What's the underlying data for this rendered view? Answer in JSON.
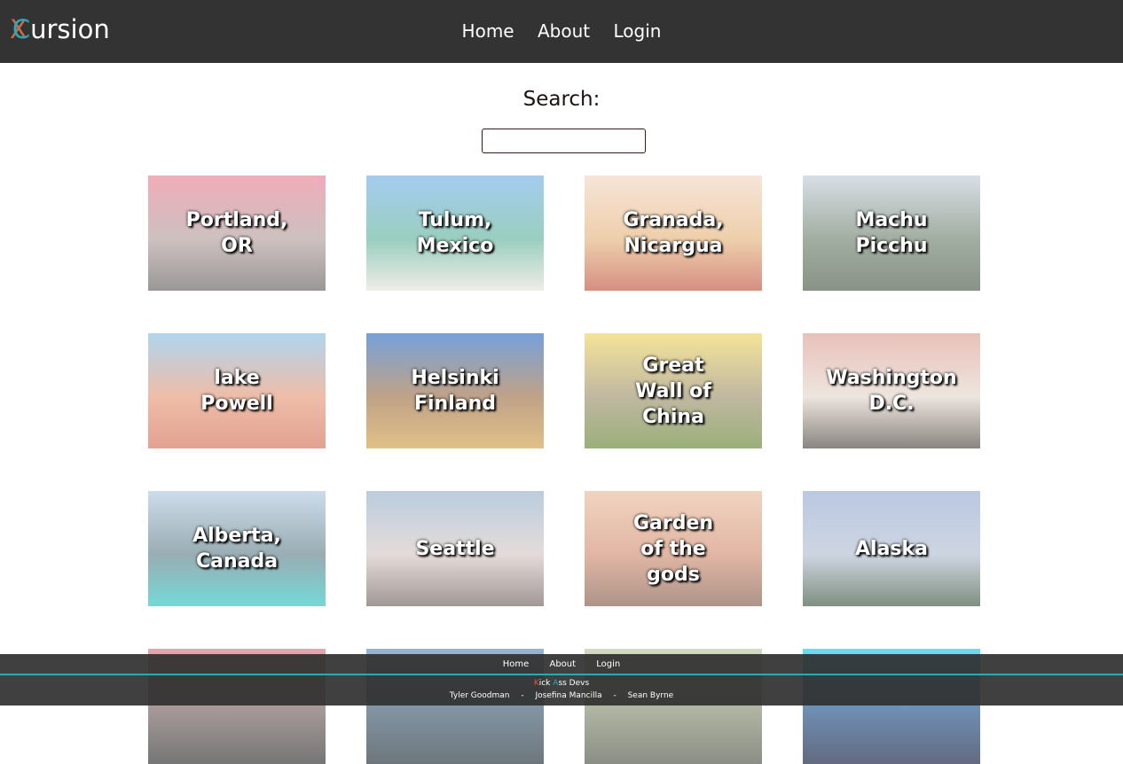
{
  "header": {
    "logo_x": "X",
    "logo_c": "C",
    "logo_rest": "ursion",
    "nav": [
      "Home",
      "About",
      "Login"
    ]
  },
  "search": {
    "label": "Search:",
    "value": "",
    "placeholder": ""
  },
  "destinations": [
    {
      "name": "Portland, OR",
      "icon": "portland-image",
      "colors": [
        "#e9899b",
        "#b9a6a5",
        "#6e6c6a"
      ]
    },
    {
      "name": "Tulum, Mexico",
      "icon": "tulum-image",
      "colors": [
        "#7cb7e8",
        "#6fb9a5",
        "#e9e6dd"
      ]
    },
    {
      "name": "Granada, Nicargua",
      "icon": "granada-image",
      "colors": [
        "#f3d9c7",
        "#e7bb88",
        "#c45f4c"
      ]
    },
    {
      "name": "Machu Picchu",
      "icon": "machu-picchu-image",
      "colors": [
        "#c7d1db",
        "#7b8b7a",
        "#566353"
      ]
    },
    {
      "name": "lake Powell",
      "icon": "lake-powell-image",
      "colors": [
        "#8ec4e8",
        "#e7a183",
        "#d77963"
      ]
    },
    {
      "name": "Helsinki Finland",
      "icon": "helsinki-image",
      "colors": [
        "#3c79c9",
        "#a57a55",
        "#d4a654"
      ]
    },
    {
      "name": "Great Wall of China",
      "icon": "great-wall-image",
      "colors": [
        "#f1d86d",
        "#a69a79",
        "#6f8d41"
      ]
    },
    {
      "name": "Washington D.C.",
      "icon": "washington-image",
      "colors": [
        "#dfa79c",
        "#e6dad1",
        "#57504a"
      ]
    },
    {
      "name": "Alberta, Canada",
      "icon": "alberta-image",
      "colors": [
        "#b7cde3",
        "#6e8a93",
        "#37c9c4"
      ]
    },
    {
      "name": "Seattle",
      "icon": "seattle-image",
      "colors": [
        "#9db7d1",
        "#d9ccc9",
        "#7a6d6a"
      ]
    },
    {
      "name": "Garden of the gods",
      "icon": "garden-of-gods-image",
      "colors": [
        "#eac2a5",
        "#d5977d",
        "#8a6656"
      ]
    },
    {
      "name": "Alaska",
      "icon": "alaska-image",
      "colors": [
        "#9db1d6",
        "#b9c3d6",
        "#48604a"
      ]
    },
    {
      "name": "",
      "icon": "destination-image",
      "colors": [
        "#d97f8a",
        "#7c6a6a",
        "#3b3b3b"
      ]
    },
    {
      "name": "",
      "icon": "destination-image",
      "colors": [
        "#6f93b8",
        "#4a6378",
        "#2f3c44"
      ]
    },
    {
      "name": "",
      "icon": "destination-image",
      "colors": [
        "#bfcba9",
        "#8a9278",
        "#5a5e52"
      ]
    },
    {
      "name": "",
      "icon": "destination-image",
      "colors": [
        "#27d3e8",
        "#305a8f",
        "#1f2b4a"
      ]
    }
  ],
  "footer": {
    "nav": [
      "Home",
      "About",
      "Login"
    ],
    "brand_k": "K",
    "brand_ick": "ick ",
    "brand_a": "A",
    "brand_rest": "ss Devs",
    "names": [
      "Tyler Goodman",
      "-",
      "Josefina Mancilla",
      "-",
      "Sean Byrne"
    ]
  }
}
